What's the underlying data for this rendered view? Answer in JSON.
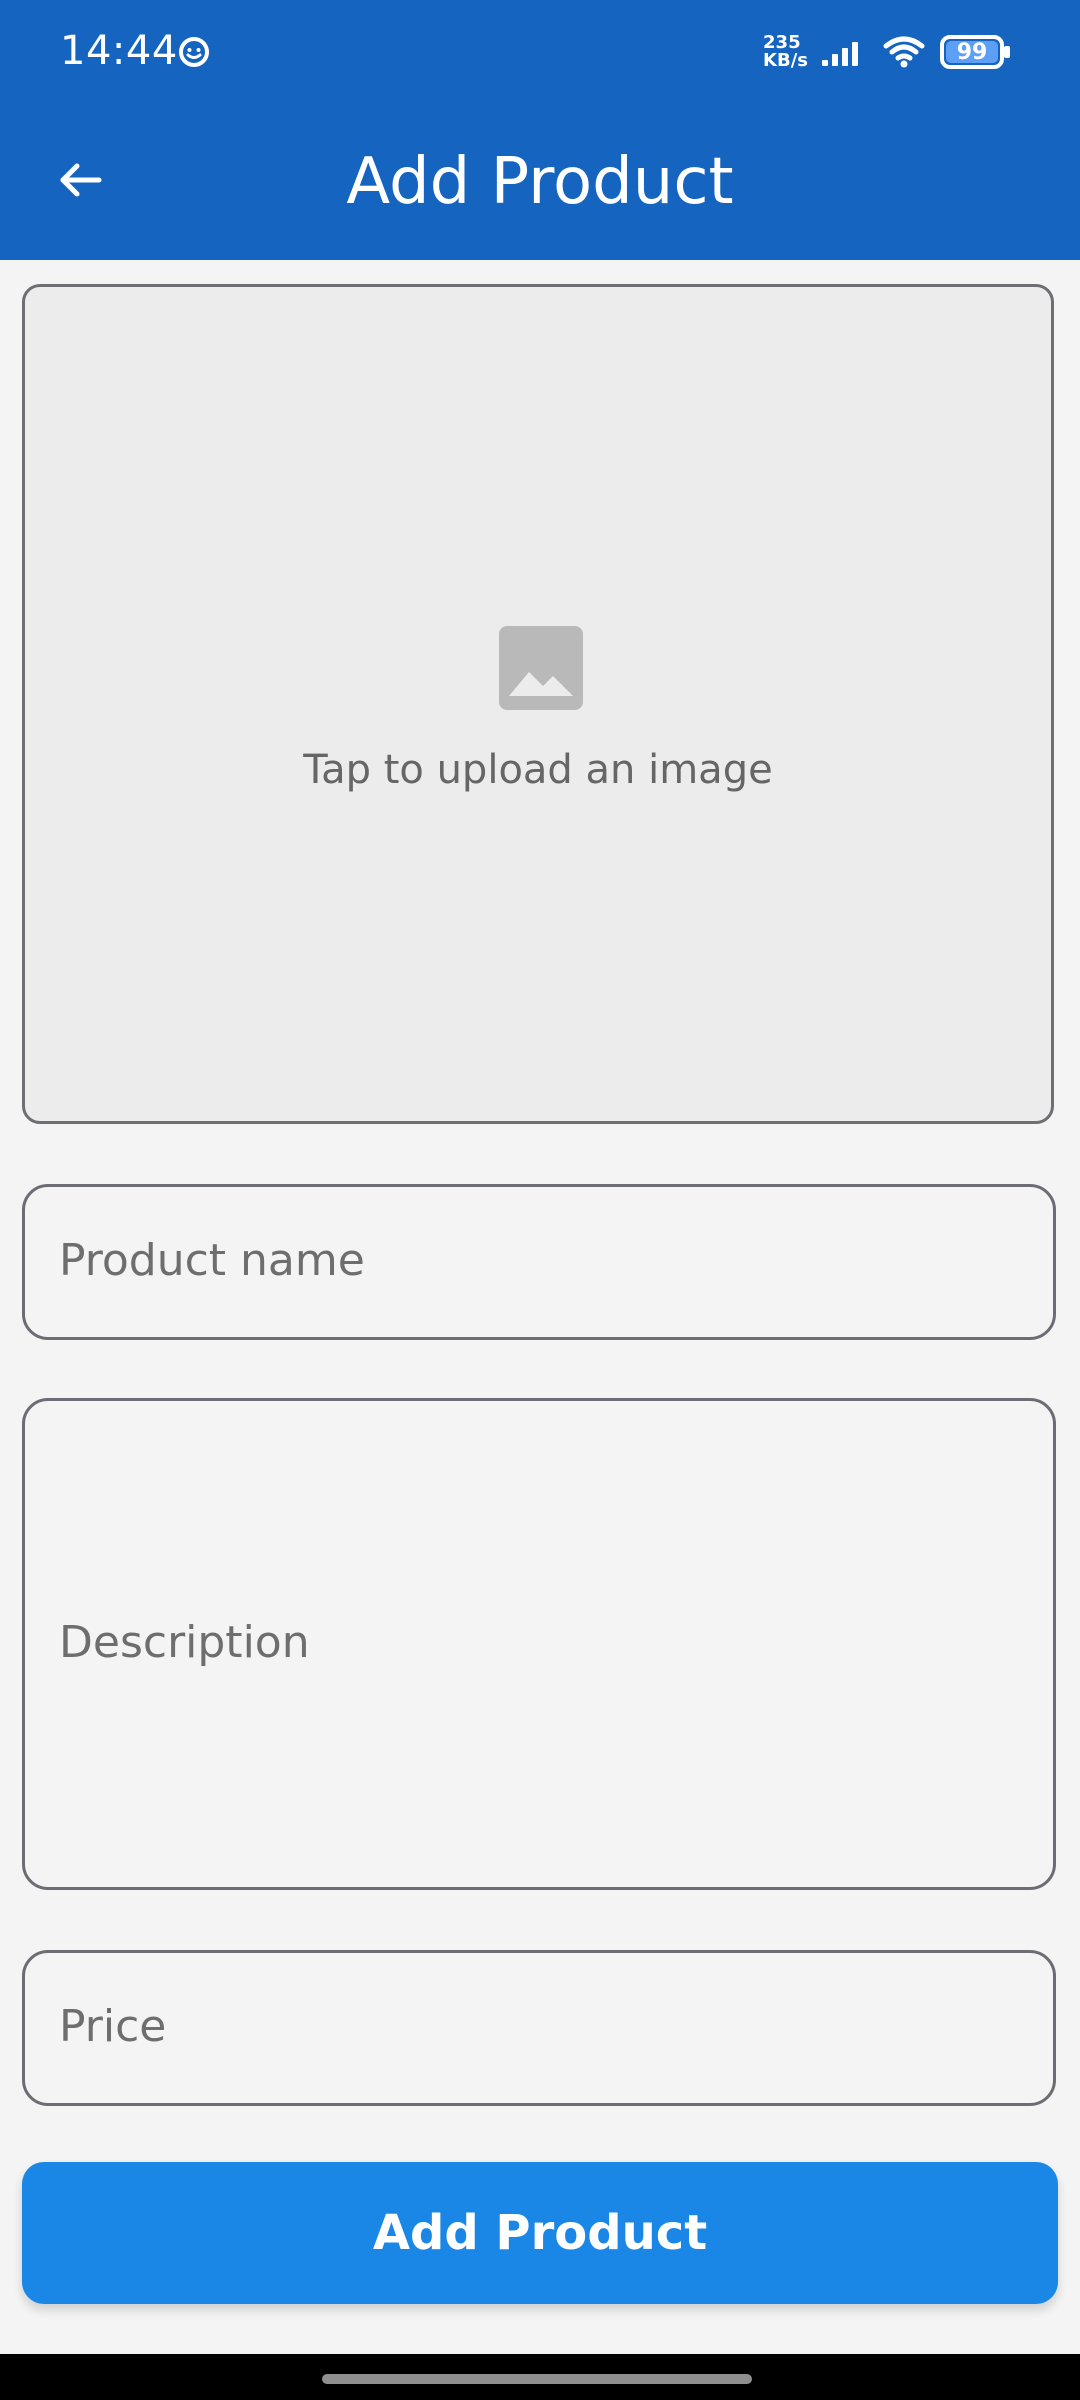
{
  "status_bar": {
    "time": "14:44",
    "net_speed_value": "235",
    "net_speed_unit": "KB/s",
    "battery": "99",
    "icons": [
      "face-icon",
      "signal-icon",
      "wifi-icon",
      "battery-icon"
    ]
  },
  "app_bar": {
    "title": "Add Product",
    "back_icon": "arrow-left-icon"
  },
  "upload": {
    "icon": "image-icon",
    "text": "Tap to upload an image"
  },
  "fields": {
    "name_placeholder": "Product name",
    "description_placeholder": "Description",
    "price_placeholder": "Price"
  },
  "actions": {
    "add_button": "Add Product"
  },
  "colors": {
    "primary": "#1565c0",
    "button": "#1a87e6",
    "background": "#f4f4f4",
    "field_border": "#6c6c74"
  }
}
